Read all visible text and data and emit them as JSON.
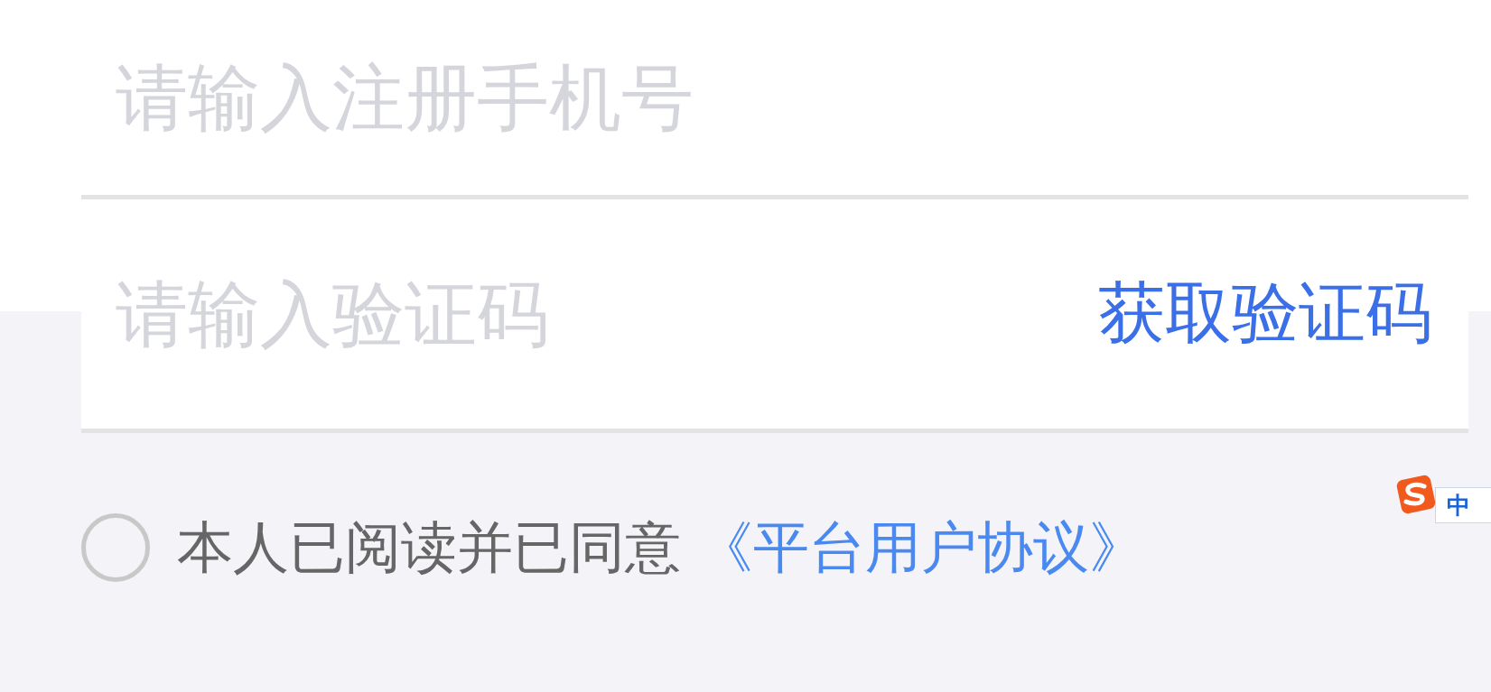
{
  "phone_field": {
    "placeholder": "请输入注册手机号"
  },
  "code_field": {
    "placeholder": "请输入验证码",
    "action": "获取验证码"
  },
  "agreement": {
    "checked": false,
    "text": "本人已阅读并已同意",
    "link": "《平台用户协议》"
  },
  "ime_badge": {
    "label": "中"
  }
}
